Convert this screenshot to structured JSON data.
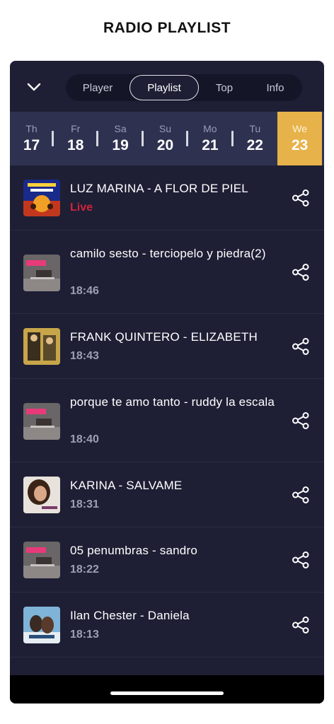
{
  "page": {
    "title": "RADIO PLAYLIST"
  },
  "tabs": [
    {
      "label": "Player"
    },
    {
      "label": "Playlist"
    },
    {
      "label": "Top"
    },
    {
      "label": "Info"
    }
  ],
  "active_tab": "Playlist",
  "days": [
    {
      "name": "Th",
      "date": "17"
    },
    {
      "name": "Fr",
      "date": "18"
    },
    {
      "name": "Sa",
      "date": "19"
    },
    {
      "name": "Su",
      "date": "20"
    },
    {
      "name": "Mo",
      "date": "21"
    },
    {
      "name": "Tu",
      "date": "22"
    },
    {
      "name": "We",
      "date": "23"
    }
  ],
  "active_day": "23",
  "colors": {
    "accent": "#e7b24a",
    "live": "#d0243a",
    "card_bg": "#1e1f35",
    "strip_bg": "#2f3150"
  },
  "playlist": [
    {
      "title": "LUZ MARINA - A FLOR DE PIEL",
      "time": "Live",
      "cover": "cover-illustrated"
    },
    {
      "title": "camilo sesto - terciopelo y piedra(2)",
      "time": "18:46",
      "cover": "cover-nostalgica"
    },
    {
      "title": "FRANK QUINTERO - ELIZABETH",
      "time": "18:43",
      "cover": "cover-photo"
    },
    {
      "title": "porque te amo tanto - ruddy la escala",
      "time": "18:40",
      "cover": "cover-nostalgica"
    },
    {
      "title": "KARINA - SALVAME",
      "time": "18:31",
      "cover": "cover-portrait"
    },
    {
      "title": "05 penumbras - sandro",
      "time": "18:22",
      "cover": "cover-nostalgica"
    },
    {
      "title": "Ilan Chester - Daniela",
      "time": "18:13",
      "cover": "cover-couple"
    }
  ],
  "icons": {
    "collapse": "chevron-down-icon",
    "share": "share-icon"
  }
}
